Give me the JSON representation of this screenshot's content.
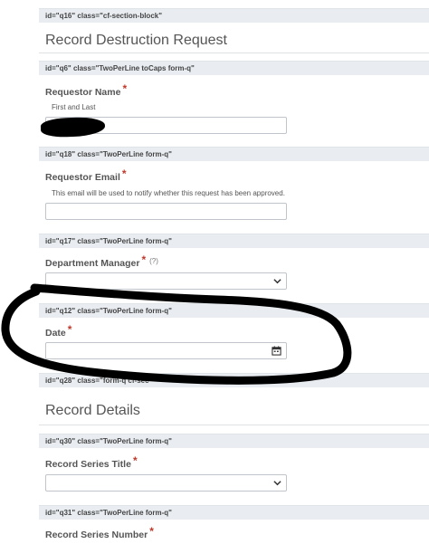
{
  "bars": {
    "q16": {
      "id": "id=\"q16\"",
      "cls": "class=\"cf-section-block\""
    },
    "q6": {
      "id": "id=\"q6\"",
      "cls": "class=\"TwoPerLine toCaps form-q\""
    },
    "q18": {
      "id": "id=\"q18\"",
      "cls": "class=\"TwoPerLine form-q\""
    },
    "q17": {
      "id": "id=\"q17\"",
      "cls": "class=\"TwoPerLine form-q\""
    },
    "q12": {
      "id": "id=\"q12\"",
      "cls": "class=\"TwoPerLine form-q\""
    },
    "q28": {
      "id": "id=\"q28\"",
      "cls": "class=\"form-q cf-sec"
    },
    "q30": {
      "id": "id=\"q30\"",
      "cls": "class=\"TwoPerLine form-q\""
    },
    "q31": {
      "id": "id=\"q31\"",
      "cls": "class=\"TwoPerLine form-q\""
    }
  },
  "sections": {
    "record_destruction": "Record Destruction Request",
    "record_details": "Record Details"
  },
  "fields": {
    "requestor_name": {
      "label": "Requestor Name",
      "required": "*",
      "sublabel": "First and Last",
      "value": ""
    },
    "requestor_email": {
      "label": "Requestor Email",
      "required": "*",
      "note": "This email will be used to notify whether this request has been approved.",
      "value": ""
    },
    "department_manager": {
      "label": "Department Manager",
      "required": "*",
      "help": "(?)",
      "selected": ""
    },
    "date": {
      "label": "Date",
      "required": "*",
      "value": ""
    },
    "record_series_title": {
      "label": "Record Series Title",
      "required": "*",
      "selected": ""
    },
    "record_series_number": {
      "label": "Record Series Number",
      "required": "*"
    }
  },
  "icons": {
    "dropdown": "chevron-down-icon",
    "date": "calendar-icon"
  },
  "colors": {
    "required": "#c0392b",
    "id_bar": "#e9edf1"
  }
}
